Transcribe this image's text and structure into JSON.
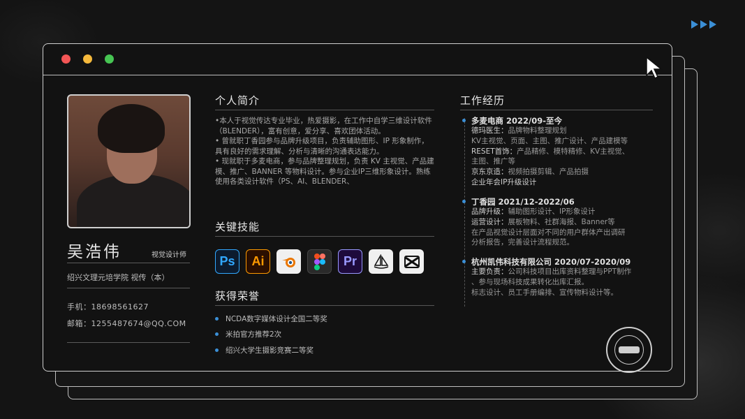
{
  "window": {
    "controls": [
      "close",
      "minimize",
      "maximize"
    ]
  },
  "profile": {
    "name": "吴浩伟",
    "role": "视觉设计师",
    "school": "绍兴文理元培学院  视传（本）",
    "phone": "手机：18698561627",
    "email": "邮箱：1255487674@QQ.COM"
  },
  "intro": {
    "title": "个人简介",
    "paragraphs": [
      "•本人于视觉传达专业毕业，热爱摄影，在工作中自学三维设计软件（BLENDER），富有创意，爱分享、喜欢团体活动。",
      "• 曾就职丁香园参与品牌升级项目，负责辅助图形、IP 形象制作，具有良好的需求理解、分析与清晰的沟通表达能力。",
      "• 现就职于多麦电商，参与品牌整理规划，负责 KV 主视觉、产品建模、推广、BANNER 等物料设计。参与企业IP三维形象设计。熟练使用各类设计软件（PS、AI、BLENDER、"
    ]
  },
  "skills": {
    "title": "关键技能",
    "items": [
      {
        "icon": "photoshop-icon",
        "label": "Ps",
        "color": "#31a8ff"
      },
      {
        "icon": "illustrator-icon",
        "label": "Ai",
        "color": "#ff9a00"
      },
      {
        "icon": "blender-icon",
        "label": "",
        "color": "#ea7600"
      },
      {
        "icon": "figma-icon",
        "label": "",
        "color": "#a259ff"
      },
      {
        "icon": "premiere-icon",
        "label": "Pr",
        "color": "#9999ff"
      },
      {
        "icon": "midjourney-icon",
        "label": "",
        "color": "#111111"
      },
      {
        "icon": "capcut-icon",
        "label": "",
        "color": "#111111"
      }
    ]
  },
  "honors": {
    "title": "获得荣誉",
    "items": [
      "NCDA数字媒体设计全国二等奖",
      "米拍官方推荐2次",
      "绍兴大学生摄影竞赛二等奖"
    ]
  },
  "experience": {
    "title": "工作经历",
    "jobs": [
      {
        "header": "多麦电商  2022/09-至今",
        "lines": [
          {
            "k": "德玛医生：",
            "v": "品牌物料整理规划"
          },
          {
            "k": "",
            "v": "KV主视觉、页面、主图、推广设计、产品建模等"
          },
          {
            "k": "RESET首饰：",
            "v": "产品精修、模特精修、KV主视觉、"
          },
          {
            "k": "",
            "v": "主图、推广等"
          },
          {
            "k": "京东京造：",
            "v": "视频拍摄剪辑、产品拍摄"
          },
          {
            "k": "企业年会IP升级设计",
            "v": ""
          }
        ]
      },
      {
        "header": "丁香园  2021/12-2022/06",
        "lines": [
          {
            "k": "品牌升级：",
            "v": "辅助图形设计、IP形象设计"
          },
          {
            "k": "运营设计：",
            "v": "展板物料、社群海报、Banner等"
          },
          {
            "k": "",
            "v": "在产品视觉设计层面对不同的用户群体产出调研"
          },
          {
            "k": "",
            "v": "分析报告，完善设计流程规范。"
          }
        ]
      },
      {
        "header": "杭州凯伟科技有限公司  2020/07-2020/09",
        "lines": [
          {
            "k": "主要负责：",
            "v": "公司科技项目出库资料整理与PPT制作"
          },
          {
            "k": "",
            "v": "、参与现场科技成果转化出库汇报。"
          },
          {
            "k": "",
            "v": "标志设计、员工手册编排、宣传物料设计等。"
          }
        ]
      }
    ]
  },
  "colors": {
    "accent": "#3b8fd6",
    "background": "#141414",
    "border": "#cfcfcf"
  }
}
